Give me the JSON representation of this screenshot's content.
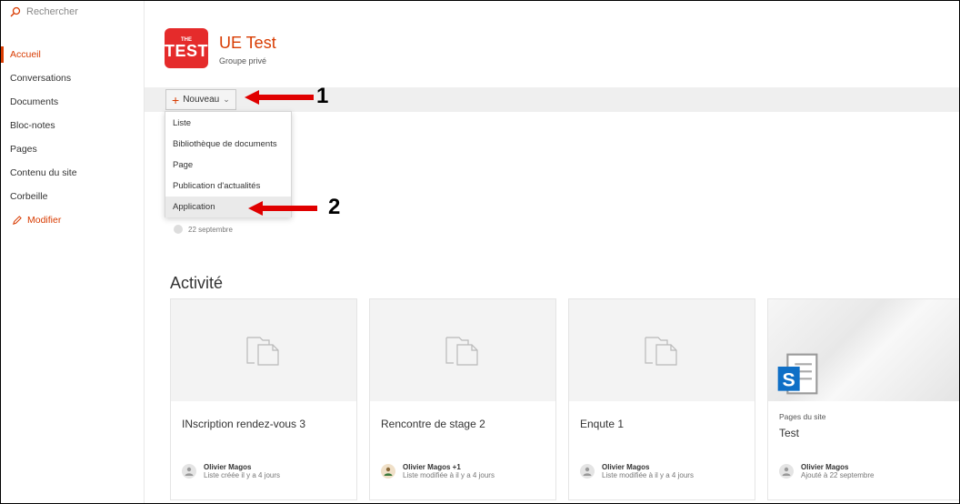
{
  "search": {
    "placeholder": "Rechercher"
  },
  "sidebar": {
    "items": [
      {
        "label": "Accueil",
        "active": true
      },
      {
        "label": "Conversations"
      },
      {
        "label": "Documents"
      },
      {
        "label": "Bloc-notes"
      },
      {
        "label": "Pages"
      },
      {
        "label": "Contenu du site"
      },
      {
        "label": "Corbeille"
      }
    ],
    "edit_label": "Modifier"
  },
  "site": {
    "logo_small": "THE",
    "logo_big": "TEST",
    "title": "UE Test",
    "subtitle": "Groupe privé"
  },
  "toolbar": {
    "new_label": "Nouveau"
  },
  "dropdown": {
    "items": [
      "Liste",
      "Bibliothèque de documents",
      "Page",
      "Publication d'actualités",
      "Application"
    ]
  },
  "annotations": {
    "label1": "1",
    "label2": "2"
  },
  "hidden_item": {
    "date": "22 septembre"
  },
  "activity": {
    "title": "Activité",
    "cards": [
      {
        "title": "INscription rendez-vous 3",
        "author": "Olivier Magos",
        "desc": "Liste créée il y a 4 jours"
      },
      {
        "title": "Rencontre de stage 2",
        "author": "Olivier Magos +1",
        "desc": "Liste modifiée à il y a 4 jours"
      },
      {
        "title": "Enqute 1",
        "author": "Olivier Magos",
        "desc": "Liste modifiée à il y a 4 jours"
      },
      {
        "kicker": "Pages du site",
        "title": "Test",
        "author": "Olivier Magos",
        "desc": "Ajouté à 22 septembre"
      }
    ]
  },
  "colors": {
    "accent": "#d83b01",
    "logo": "#e52b2b",
    "arrow": "#e00000"
  }
}
